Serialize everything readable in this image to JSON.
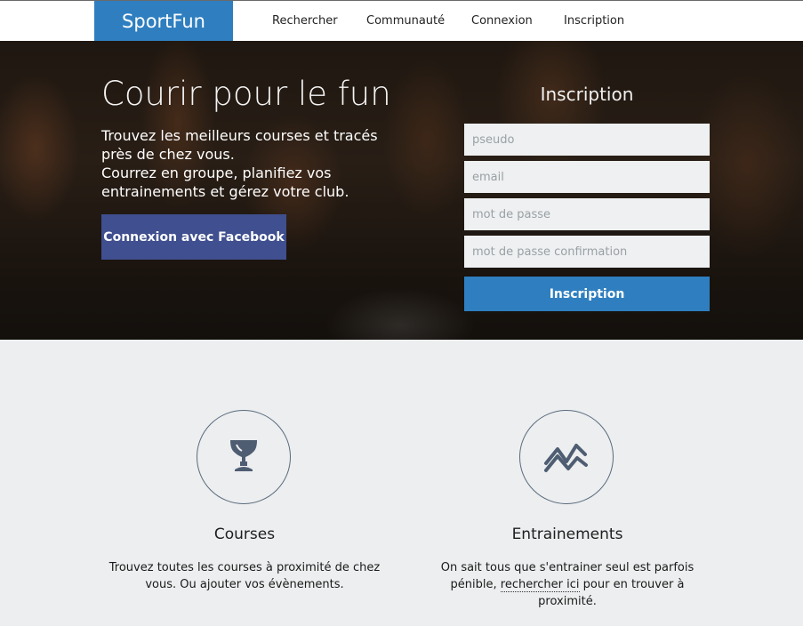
{
  "nav": {
    "brand": "SportFun",
    "items": [
      "Rechercher",
      "Communauté",
      "Connexion",
      "Inscription"
    ]
  },
  "hero": {
    "title": "Courir pour le fun",
    "line1": "Trouvez les meilleurs courses et tracés près de chez vous.",
    "line2": "Courrez en groupe, planifiez vos entrainements et gérez votre club.",
    "facebook_button": "Connexion avec Facebook"
  },
  "signup": {
    "title": "Inscription",
    "pseudo_placeholder": "pseudo",
    "email_placeholder": "email",
    "password_placeholder": "mot de passe",
    "password_confirm_placeholder": "mot de passe confirmation",
    "submit_label": "Inscription",
    "submit_color": "#2f7fc0"
  },
  "features": [
    {
      "icon": "trophy-icon",
      "title": "Courses",
      "text": "Trouvez toutes les courses à proximité de chez vous. Ou ajouter vos évènements."
    },
    {
      "icon": "chart-lines-icon",
      "title": "Entrainements",
      "text_before": "On sait tous que s'entrainer seul est parfois pénible, ",
      "link": "rechercher ici",
      "text_after": " pour en trouver à proximité."
    }
  ],
  "colors": {
    "brand": "#2f7fc0",
    "facebook": "#3f4f8f",
    "icon": "#4f5d72"
  }
}
